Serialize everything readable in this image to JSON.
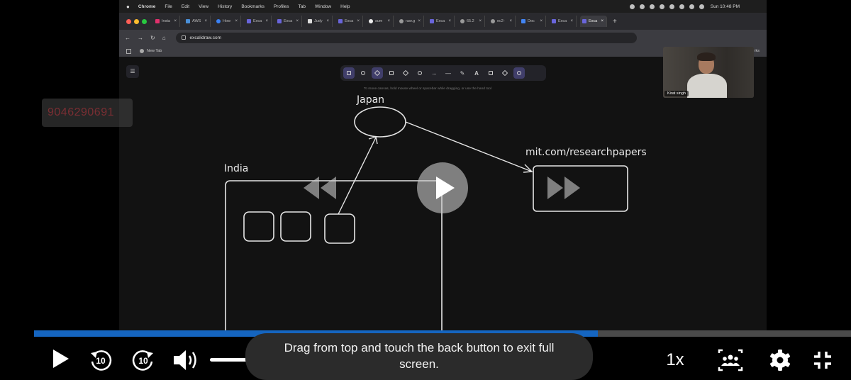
{
  "menubar": {
    "app": "Chrome",
    "items": [
      "File",
      "Edit",
      "View",
      "History",
      "Bookmarks",
      "Profiles",
      "Tab",
      "Window",
      "Help"
    ],
    "clock": "Sun 10:48 PM"
  },
  "tabs": [
    {
      "label": "Insta"
    },
    {
      "label": "AWS"
    },
    {
      "label": "How"
    },
    {
      "label": "Exca"
    },
    {
      "label": "Exca"
    },
    {
      "label": "Judy"
    },
    {
      "label": "Exca"
    },
    {
      "label": "sum"
    },
    {
      "label": "raw.g"
    },
    {
      "label": "Exca"
    },
    {
      "label": "65.2"
    },
    {
      "label": "ec2-"
    },
    {
      "label": "Doc"
    },
    {
      "label": "Exca"
    },
    {
      "label": "Exca"
    }
  ],
  "browser": {
    "url": "excalidraw.com",
    "bookmark": "New Tab",
    "right_fragment": "rks"
  },
  "canvas": {
    "hint": "To move canvas, hold mouse wheel or spacebar while dragging, or use the hand tool",
    "labels": {
      "japan": "Japan",
      "india": "India",
      "mit": "mit.com/researchpapers"
    }
  },
  "webcam": {
    "name": "Kirat singh"
  },
  "overlay": {
    "phone": "9046290691"
  },
  "player": {
    "progress": 0.69,
    "speed": "1x",
    "toast": "Drag from top and touch the back button to exit full screen.",
    "skip_seconds": "10"
  },
  "colors": {
    "progress": "#1565c0",
    "toolbar_selected": "#403e6a",
    "badge_text": "#7a2e33"
  }
}
